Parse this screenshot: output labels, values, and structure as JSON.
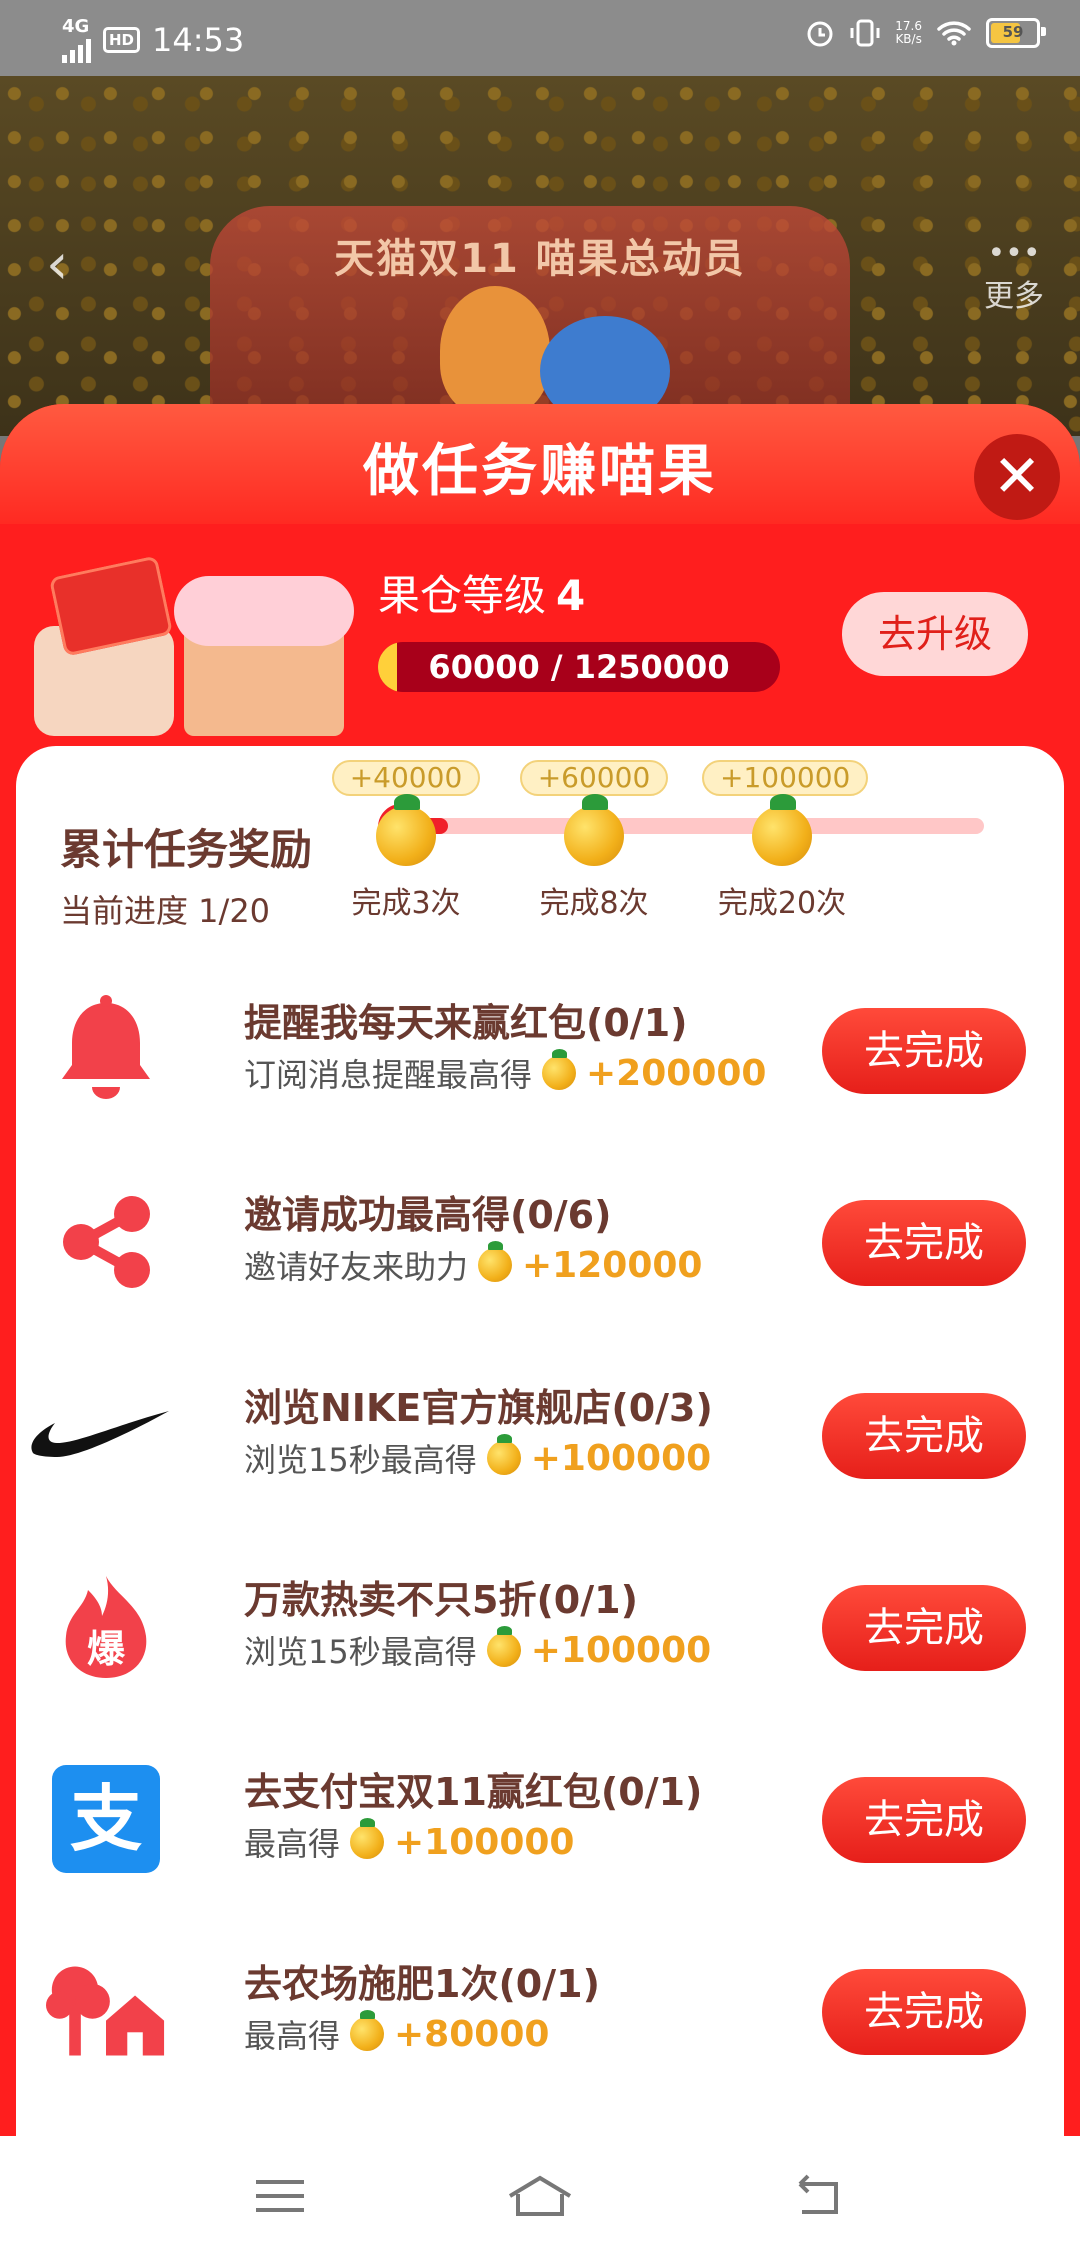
{
  "status_bar": {
    "network": "4G",
    "hd": "HD",
    "time": "14:53",
    "speed_value": "17.6",
    "speed_unit": "KB/s",
    "battery": "59"
  },
  "banner": {
    "subtitle": "天猫双11 喵果总动员",
    "more_label": "更多"
  },
  "sheet": {
    "title": "做任务赚喵果",
    "close": "✕",
    "level_label": "果仓等级",
    "level_value": "4",
    "progress_text": "60000 / 1250000",
    "progress_fraction": 0.048,
    "upgrade_button": "去升级"
  },
  "cumulative": {
    "title": "累计任务奖励",
    "progress": "当前进度 1/20",
    "fraction_done": 0.0,
    "milestones": [
      {
        "reward": "+40000",
        "label": "完成3次"
      },
      {
        "reward": "+60000",
        "label": "完成8次"
      },
      {
        "reward": "+100000",
        "label": "完成20次"
      }
    ]
  },
  "tasks": [
    {
      "icon": "bell-icon",
      "title": "提醒我每天来赢红包(0/1)",
      "subtitle": "订阅消息提醒最高得",
      "amount": "+200000",
      "button": "去完成"
    },
    {
      "icon": "share-icon",
      "title": "邀请成功最高得(0/6)",
      "subtitle": "邀请好友来助力",
      "amount": "+120000",
      "button": "去完成"
    },
    {
      "icon": "nike-logo-icon",
      "title": "浏览NIKE官方旗舰店(0/3)",
      "subtitle": "浏览15秒最高得",
      "amount": "+100000",
      "button": "去完成"
    },
    {
      "icon": "hot-sale-icon",
      "icon_text": "爆",
      "title": "万款热卖不只5折(0/1)",
      "subtitle": "浏览15秒最高得",
      "amount": "+100000",
      "button": "去完成"
    },
    {
      "icon": "alipay-icon",
      "icon_text": "支",
      "title": "去支付宝双11赢红包(0/1)",
      "subtitle": "最高得",
      "amount": "+100000",
      "button": "去完成"
    },
    {
      "icon": "farm-icon",
      "title": "去农场施肥1次(0/1)",
      "subtitle": "最高得",
      "amount": "+80000",
      "button": "去完成"
    }
  ],
  "colors": {
    "accent_red": "#ff1e1e",
    "button_red": "#e61f1a",
    "reward_gold": "#f0a01e",
    "text_brown": "#6b3a30"
  }
}
